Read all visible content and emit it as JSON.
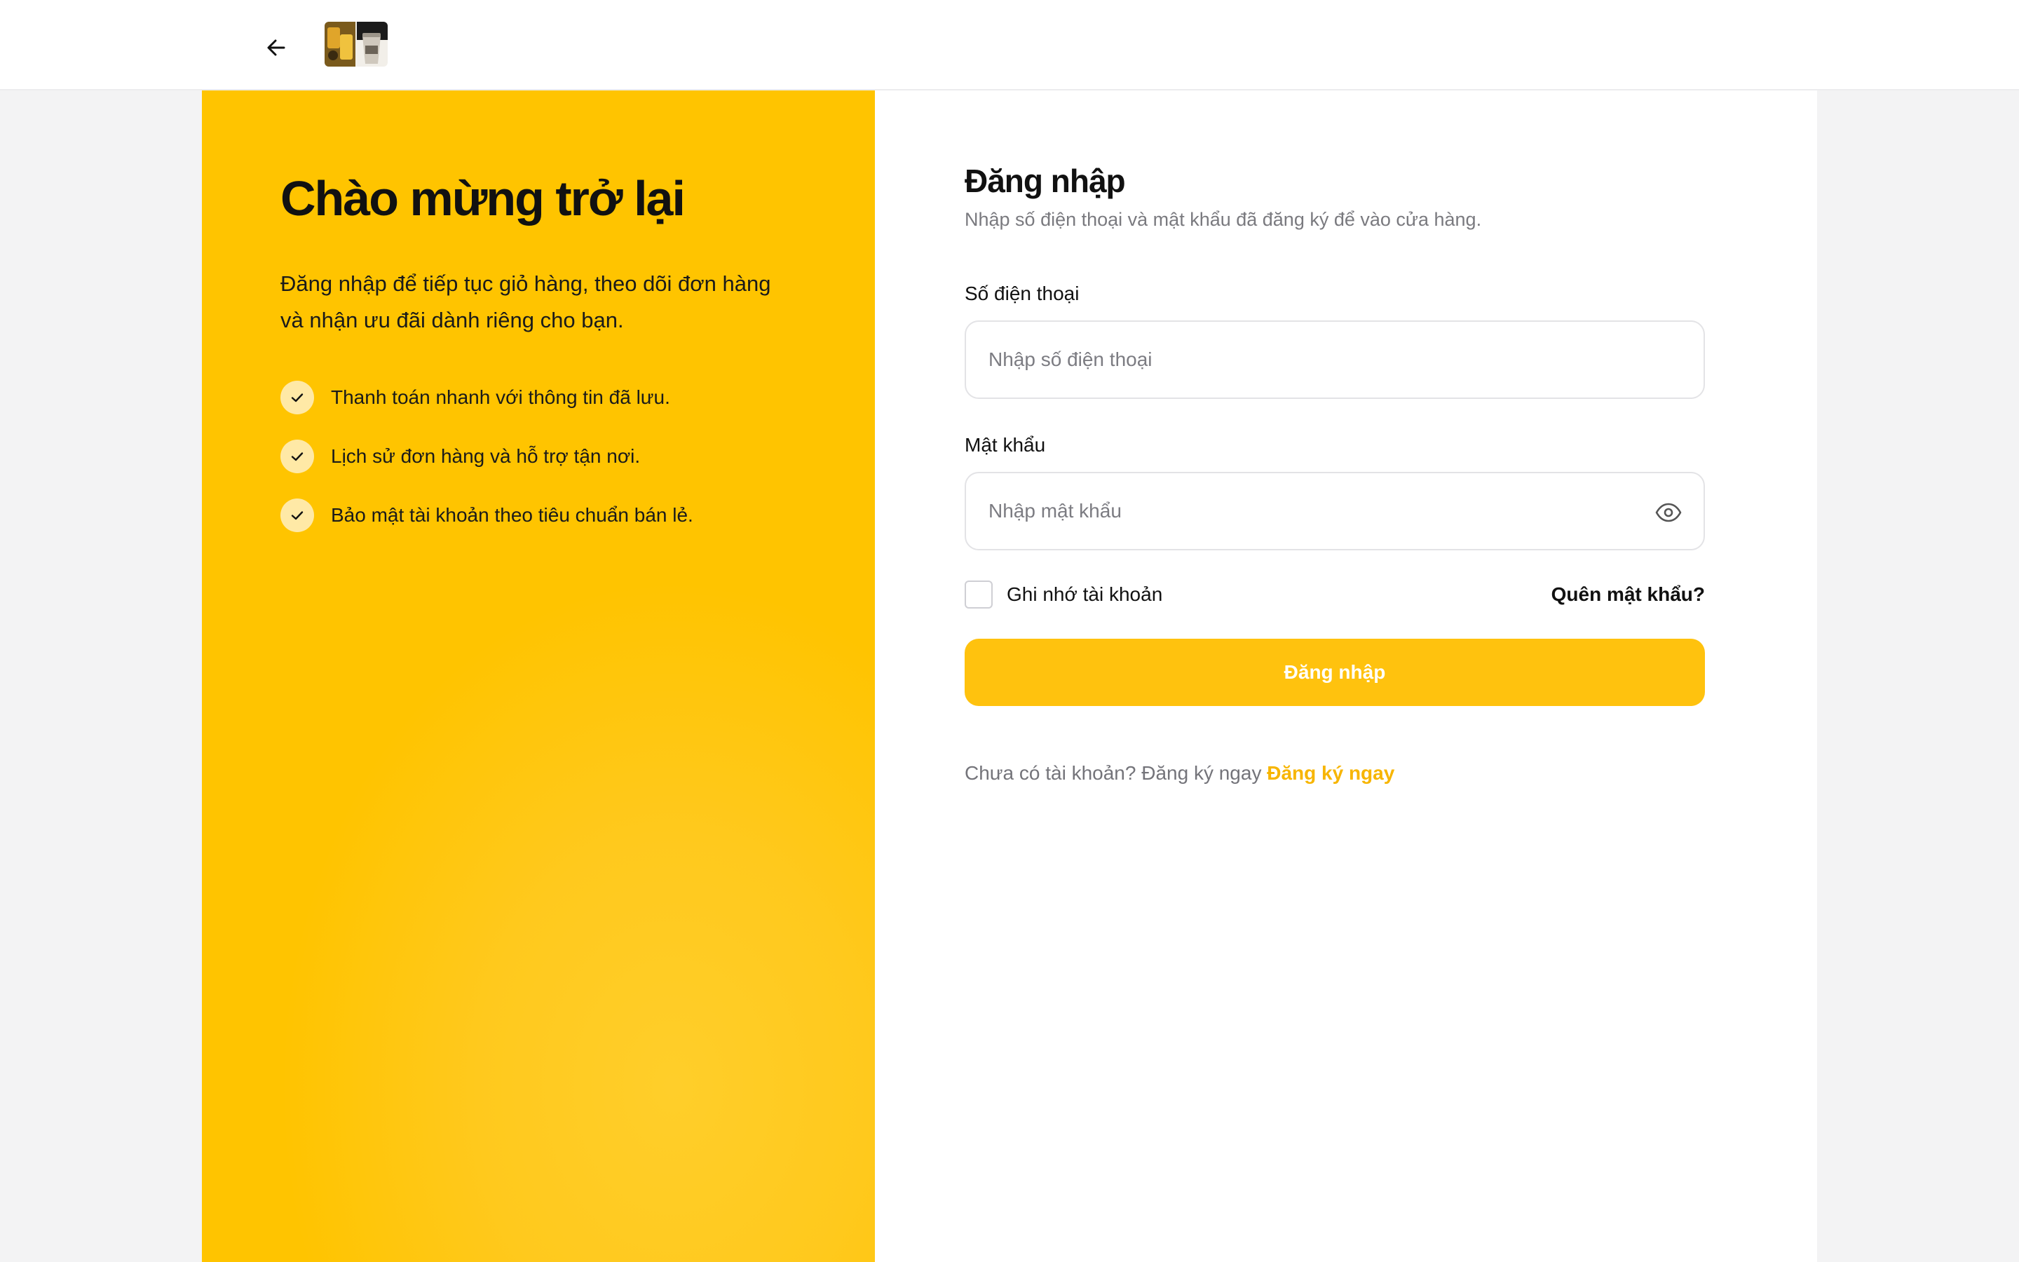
{
  "header": {
    "back_icon": "arrow-left-icon",
    "logo_alt": "store-logo"
  },
  "colors": {
    "accent": "#ffc20e",
    "hero_bg": "#ffc400",
    "link": "#f7b500",
    "check_bg": "#ffe9a6",
    "page_bg": "#f3f3f4"
  },
  "hero": {
    "title": "Chào mừng trở lại",
    "subtitle": "Đăng nhập để tiếp tục giỏ hàng, theo dõi đơn hàng và nhận ưu đãi dành riêng cho bạn.",
    "benefits": [
      "Thanh toán nhanh với thông tin đã lưu.",
      "Lịch sử đơn hàng và hỗ trợ tận nơi.",
      "Bảo mật tài khoản theo tiêu chuẩn bán lẻ."
    ]
  },
  "form": {
    "title": "Đăng nhập",
    "subtitle": "Nhập số điện thoại và mật khẩu đã đăng ký để vào cửa hàng.",
    "phone_label": "Số điện thoại",
    "phone_placeholder": "Nhập số điện thoại",
    "phone_value": "",
    "password_label": "Mật khẩu",
    "password_placeholder": "Nhập mật khẩu",
    "password_value": "",
    "remember_label": "Ghi nhớ tài khoản",
    "forgot_label": "Quên mật khẩu?",
    "submit_label": "Đăng nhập",
    "signup_prompt": "Chưa có tài khoản? Đăng ký ngay",
    "signup_link": "Đăng ký ngay"
  }
}
